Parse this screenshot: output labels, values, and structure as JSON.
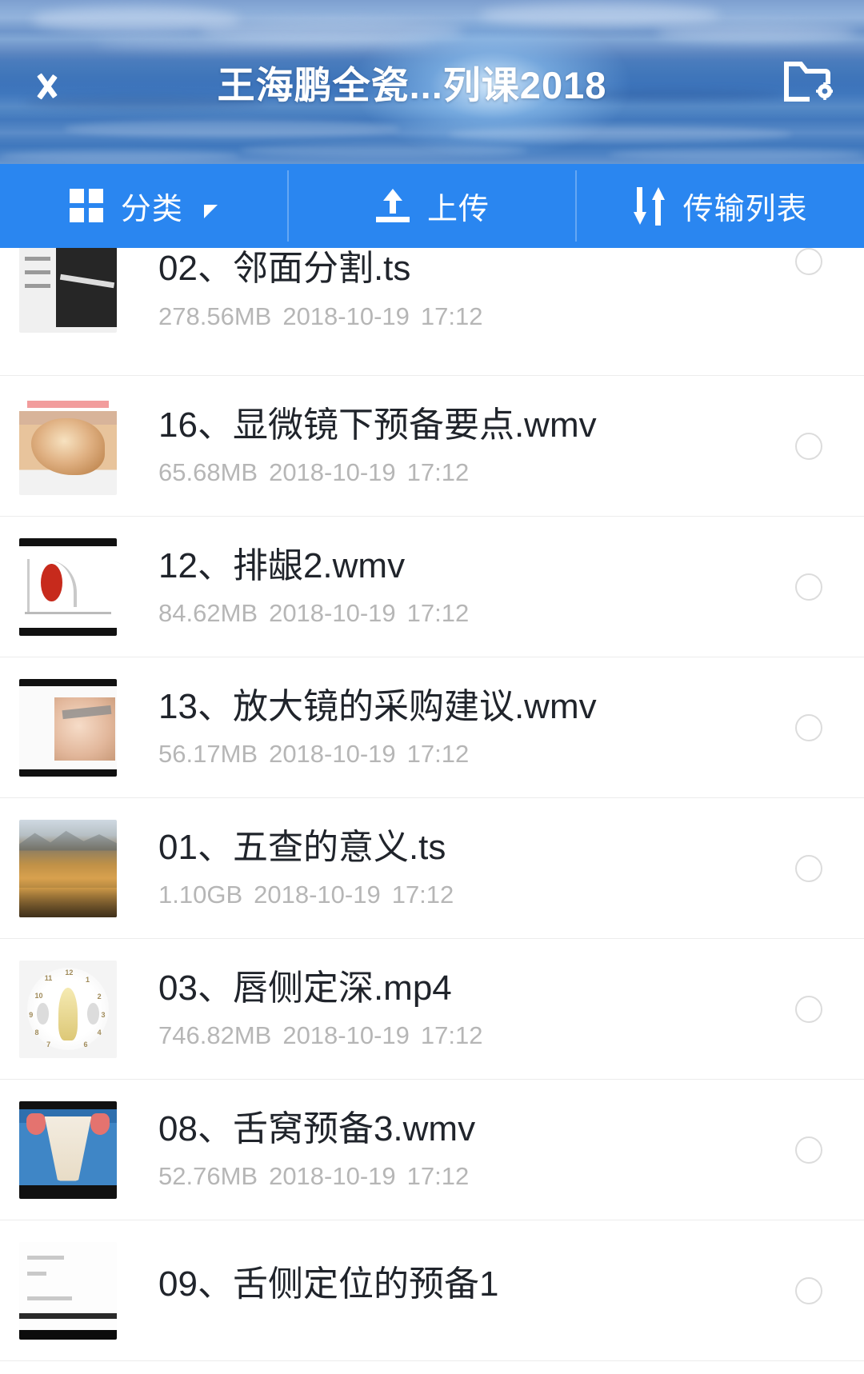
{
  "header": {
    "back_icon": "back-chevron-icon",
    "title": "王海鹏全瓷...列课2018",
    "action_icon": "folder-settings-icon"
  },
  "toolbar": {
    "category": {
      "label": "分类",
      "icon": "grid-icon",
      "caret": "triangle-down-icon"
    },
    "upload": {
      "label": "上传",
      "icon": "upload-icon"
    },
    "transfer": {
      "label": "传输列表",
      "icon": "transfer-arrows-icon"
    }
  },
  "file_list": {
    "select_icon": "radio-unchecked-icon",
    "items": [
      {
        "name": "02、邻面分割.ts",
        "size": "278.56MB",
        "date": "2018-10-19",
        "time": "17:12",
        "thumb": "tn-slide1",
        "selected": false
      },
      {
        "name": "16、显微镜下预备要点.wmv",
        "size": "65.68MB",
        "date": "2018-10-19",
        "time": "17:12",
        "thumb": "tn-oral",
        "selected": false
      },
      {
        "name": "12、排龈2.wmv",
        "size": "84.62MB",
        "date": "2018-10-19",
        "time": "17:12",
        "thumb": "tn-chart",
        "selected": false
      },
      {
        "name": "13、放大镜的采购建议.wmv",
        "size": "56.17MB",
        "date": "2018-10-19",
        "time": "17:12",
        "thumb": "tn-face",
        "selected": false
      },
      {
        "name": "01、五查的意义.ts",
        "size": "1.10GB",
        "date": "2018-10-19",
        "time": "17:12",
        "thumb": "tn-land",
        "selected": false
      },
      {
        "name": "03、唇侧定深.mp4",
        "size": "746.82MB",
        "date": "2018-10-19",
        "time": "17:12",
        "thumb": "tn-clock",
        "selected": false
      },
      {
        "name": "08、舌窝预备3.wmv",
        "size": "52.76MB",
        "date": "2018-10-19",
        "time": "17:12",
        "thumb": "tn-tooth",
        "selected": false
      },
      {
        "name": "09、舌侧定位的预备1",
        "size": "",
        "date": "",
        "time": "",
        "thumb": "tn-doc",
        "selected": false
      }
    ]
  },
  "colors": {
    "accent_blue": "#2a86f0",
    "header_blue": "#4479bb",
    "row_divider": "#ececec",
    "meta_gray": "#b6b6b6",
    "name_dark": "#20242b"
  }
}
